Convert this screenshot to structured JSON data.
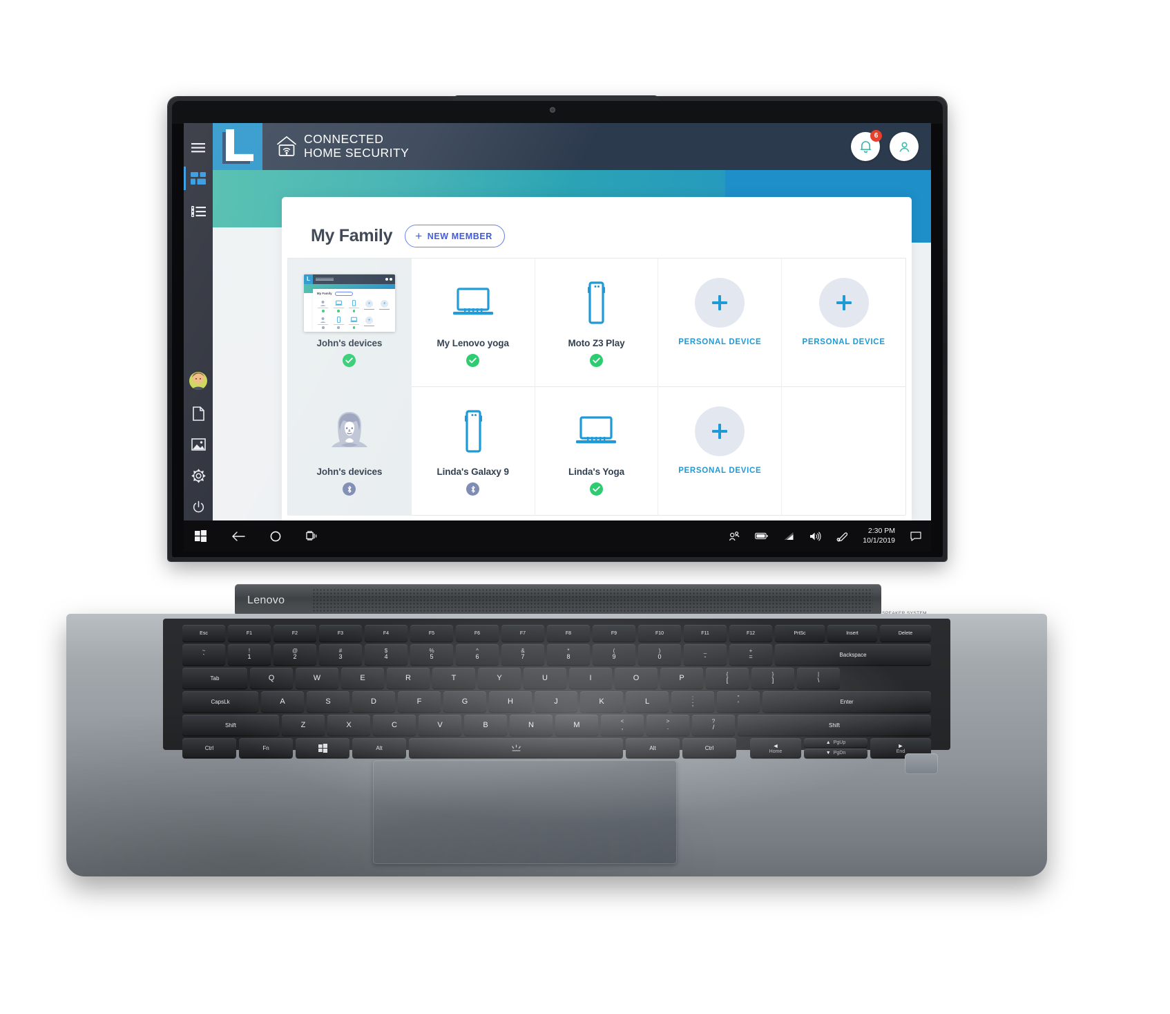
{
  "device": {
    "brand": "Lenovo",
    "speaker_label": "SPEAKER SYSTEM"
  },
  "app": {
    "logo_letter": "L",
    "brand_line1": "CONNECTED",
    "brand_line2": "HOME SECURITY",
    "notification_count": "6",
    "icons": {
      "bell": "bell-icon",
      "profile": "user-profile-icon",
      "home_wifi": "home-wifi-icon"
    }
  },
  "os_rail": {
    "items": [
      {
        "name": "hamburger-menu-icon",
        "label": "menu",
        "active": false
      },
      {
        "name": "dashboard-icon",
        "label": "dashboard",
        "active": true
      },
      {
        "name": "list-view-icon",
        "label": "list",
        "active": false
      },
      {
        "name": "user-avatar",
        "label": "account",
        "active": false
      },
      {
        "name": "document-icon",
        "label": "documents",
        "active": false
      },
      {
        "name": "image-icon",
        "label": "pictures",
        "active": false
      },
      {
        "name": "gear-icon",
        "label": "settings",
        "active": false
      },
      {
        "name": "power-icon",
        "label": "power",
        "active": false
      }
    ]
  },
  "panel": {
    "title": "My Family",
    "new_member_label": "NEW MEMBER",
    "new_member_plus": "+"
  },
  "grid": {
    "rows": [
      {
        "row_name": "john-row",
        "cells": [
          {
            "label": "John's devices",
            "art": "app-thumbnail",
            "status": "ok",
            "highlight": true,
            "type": "member"
          },
          {
            "label": "My Lenovo yoga",
            "art": "laptop-icon",
            "status": "ok",
            "highlight": false,
            "type": "device"
          },
          {
            "label": "Moto Z3 Play",
            "art": "phone-icon",
            "status": "ok",
            "highlight": false,
            "type": "device"
          },
          {
            "label": "PERSONAL DEVICE",
            "art": "plus-circle",
            "status": "none",
            "highlight": false,
            "type": "add"
          },
          {
            "label": "PERSONAL DEVICE",
            "art": "plus-circle",
            "status": "none",
            "highlight": false,
            "type": "add"
          }
        ]
      },
      {
        "row_name": "linda-row",
        "cells": [
          {
            "label": "John's devices",
            "art": "female-avatar",
            "status": "bt",
            "highlight": true,
            "type": "member"
          },
          {
            "label": "Linda's Galaxy 9",
            "art": "phone-icon",
            "status": "bt",
            "highlight": false,
            "type": "device"
          },
          {
            "label": "Linda's Yoga",
            "art": "laptop-icon",
            "status": "ok",
            "highlight": false,
            "type": "device"
          },
          {
            "label": "PERSONAL DEVICE",
            "art": "plus-circle",
            "status": "none",
            "highlight": false,
            "type": "add"
          },
          {
            "label": "",
            "art": "none",
            "status": "none",
            "highlight": false,
            "type": "empty"
          }
        ]
      }
    ]
  },
  "taskbar": {
    "left_icons": [
      "windows-start-icon",
      "back-arrow-icon",
      "cortana-circle-icon",
      "task-view-icon"
    ],
    "tray_icons": [
      "people-icon",
      "battery-icon",
      "wifi-icon",
      "volume-icon",
      "pen-icon",
      "action-center-icon"
    ],
    "time": "2:30 PM",
    "date": "10/1/2019"
  },
  "keyboard": {
    "fn_row": [
      "Esc",
      "F1",
      "F2",
      "F3",
      "F4",
      "F5",
      "F6",
      "F7",
      "F8",
      "F9",
      "F10",
      "F11",
      "F12",
      "PrtSc",
      "Insert",
      "Delete"
    ],
    "num_row_top": [
      "~",
      "!",
      "@",
      "#",
      "$",
      "%",
      "^",
      "&",
      "*",
      "(",
      ")",
      "_",
      "+"
    ],
    "num_row_bottom": [
      "`",
      "1",
      "2",
      "3",
      "4",
      "5",
      "6",
      "7",
      "8",
      "9",
      "0",
      "-",
      "="
    ],
    "backspace": "Backspace",
    "tab": "Tab",
    "row_q": [
      "Q",
      "W",
      "E",
      "R",
      "T",
      "Y",
      "U",
      "I",
      "O",
      "P",
      "{",
      "}",
      "|"
    ],
    "row_q_sub": [
      "",
      "",
      "",
      "",
      "",
      "",
      "",
      "",
      "",
      "",
      "[",
      "]",
      "\\"
    ],
    "capslock": "CapsLk",
    "row_a": [
      "A",
      "S",
      "D",
      "F",
      "G",
      "H",
      "J",
      "K",
      "L",
      ":",
      "\""
    ],
    "row_a_sub": [
      "",
      "",
      "",
      "",
      "",
      "",
      "",
      "",
      "",
      ";",
      "'"
    ],
    "enter": "Enter",
    "shift_left": "Shift",
    "row_z": [
      "Z",
      "X",
      "C",
      "V",
      "B",
      "N",
      "M",
      "<",
      ">",
      "?"
    ],
    "row_z_sub": [
      "",
      "",
      "",
      "",
      "",
      "",
      "",
      ",",
      ".",
      "/"
    ],
    "shift_right": "Shift",
    "bottom_row": [
      "Ctrl",
      "Fn",
      "win-icon",
      "Alt",
      "space",
      "Alt",
      "Ctrl"
    ],
    "arrows": {
      "up": "▲",
      "down": "▼",
      "left": "◄",
      "right": "►",
      "pgup": "PgUp",
      "pgdn": "PgDn",
      "home": "Home",
      "end": "End"
    }
  },
  "colors": {
    "brand_blue": "#1e90c8",
    "header_navy": "#2c3a4d",
    "teal": "#3fb7a6",
    "accent_blue": "#1e9ad6",
    "button_blue": "#3552d8",
    "status_green": "#2ecc71",
    "badge_red": "#e8402a",
    "rail_navy": "#1b1f2a"
  }
}
